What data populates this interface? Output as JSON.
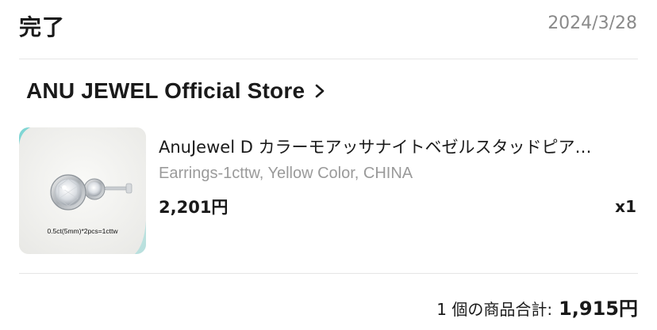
{
  "order": {
    "status": "完了",
    "date": "2024/3/28"
  },
  "store": {
    "name": "ANU JEWEL Official Store",
    "chevron_icon": "chevron-right-icon"
  },
  "item": {
    "title": "AnuJewel D カラーモアッサナイトベゼルスタッドピア…",
    "variant": "Earrings-1cttw, Yellow Color, CHINA",
    "price": "2,201円",
    "quantity": "x1",
    "image_caption": "0.5ct(5mm)*2pcs=1cttw"
  },
  "summary": {
    "label": "1 個の商品合計:",
    "total": "1,915円"
  },
  "colors": {
    "muted_text": "#8a8a8a",
    "divider": "#e6e6e6",
    "thumb_accent": "#7fd6d4"
  }
}
